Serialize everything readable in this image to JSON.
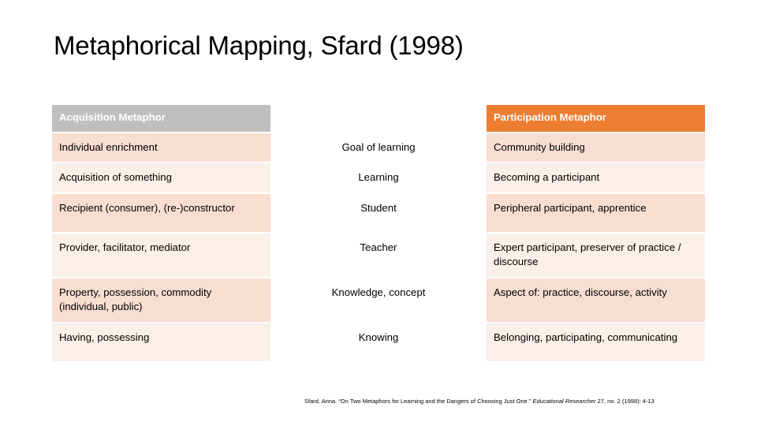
{
  "slide": {
    "title": "Metaphorical Mapping, Sfard (1998)"
  },
  "colors": {
    "header_left": "#BFBFBF",
    "header_right": "#ED7D31",
    "row_shade_dark": "#F8DDD1",
    "row_shade_light": "#FBEFEA",
    "text": "#000000",
    "header_text": "#FFFFFF"
  },
  "table": {
    "columns": [
      {
        "key": "acquisition",
        "header": "Acquisition Metaphor",
        "align": "left"
      },
      {
        "key": "dimension",
        "header": "",
        "align": "center"
      },
      {
        "key": "participation",
        "header": "Participation Metaphor",
        "align": "left"
      }
    ],
    "rows": [
      {
        "acquisition": "Individual enrichment",
        "dimension": "Goal of learning",
        "participation": "Community building"
      },
      {
        "acquisition": "Acquisition of something",
        "dimension": "Learning",
        "participation": "Becoming a participant"
      },
      {
        "acquisition": "Recipient (consumer), (re-)constructor",
        "dimension": "Student",
        "participation": "Peripheral participant, apprentice"
      },
      {
        "acquisition": "Provider, facilitator, mediator",
        "dimension": "Teacher",
        "participation": "Expert participant, preserver of practice / discourse"
      },
      {
        "acquisition": "Property, possession, commodity (individual, public)",
        "dimension": "Knowledge, concept",
        "participation": "Aspect of: practice, discourse, activity"
      },
      {
        "acquisition": "Having, possessing",
        "dimension": "Knowing",
        "participation": "Belonging, participating, communicating"
      }
    ]
  },
  "citation": {
    "author": "Sfard, Anna. ",
    "article": "“On Two Metaphors for Learning and the Dangers of Choosing Just One.” ",
    "journal": "Educational Researcher",
    "volume_issue_pages": " 27, no. 2 (1998): 4-13"
  }
}
